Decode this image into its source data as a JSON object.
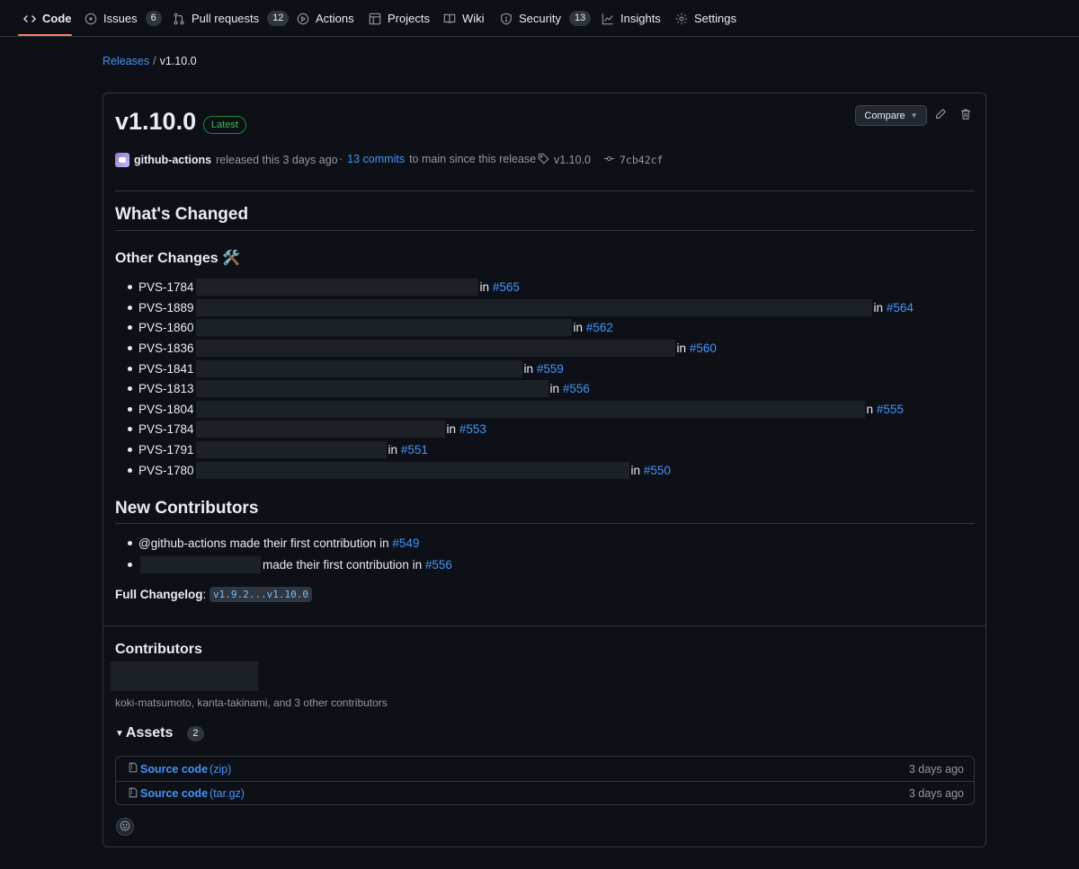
{
  "nav": {
    "code": "Code",
    "issues": "Issues",
    "issues_count": "6",
    "pulls": "Pull requests",
    "pulls_count": "12",
    "actions": "Actions",
    "projects": "Projects",
    "wiki": "Wiki",
    "security": "Security",
    "security_count": "13",
    "insights": "Insights",
    "settings": "Settings"
  },
  "breadcrumb": {
    "releases": "Releases",
    "sep": "/",
    "current": "v1.10.0"
  },
  "release": {
    "title": "v1.10.0",
    "badge": "Latest",
    "compare_label": "Compare",
    "author": "github-actions",
    "released_text": "released this 3 days ago",
    "commits_prefix": "·",
    "commits_link": "13 commits",
    "commits_suffix": "to main since this release",
    "tag": "v1.10.0",
    "commit_sha": "7cb42cf"
  },
  "body": {
    "whats_changed": "What's Changed",
    "other_changes": "Other Changes 🛠️",
    "changes": [
      {
        "id": "PVS-1784",
        "pr": "#565"
      },
      {
        "id": "PVS-1889",
        "pr": "#564"
      },
      {
        "id": "PVS-1860",
        "pr": "#562"
      },
      {
        "id": "PVS-1836",
        "pr": "#560"
      },
      {
        "id": "PVS-1841",
        "pr": "#559"
      },
      {
        "id": "PVS-1813",
        "pr": "#556"
      },
      {
        "id": "PVS-1804",
        "pr": "#555"
      },
      {
        "id": "PVS-1784",
        "pr": "#553"
      },
      {
        "id": "PVS-1791",
        "pr": "#551"
      },
      {
        "id": "PVS-1780",
        "pr": "#550"
      }
    ],
    "in_word": "in",
    "n_word": "n",
    "new_contributors": "New Contributors",
    "contrib1_text": "@github-actions made their first contribution in",
    "contrib1_pr": "#549",
    "contrib2_text": "made their first contribution in",
    "contrib2_pr": "#556",
    "full_changelog_label": "Full Changelog",
    "full_changelog_colon": ":",
    "full_changelog_link": "v1.9.2...v1.10.0"
  },
  "contributors": {
    "heading": "Contributors",
    "summary": "koki-matsumoto, kanta-takinami, and 3 other contributors"
  },
  "assets": {
    "heading": "Assets",
    "count": "2",
    "items": [
      {
        "name": "Source code",
        "ext": "(zip)",
        "date": "3 days ago"
      },
      {
        "name": "Source code",
        "ext": "(tar.gz)",
        "date": "3 days ago"
      }
    ]
  },
  "colors": {
    "accent_link": "#4493f8",
    "latest_green": "#3fb950",
    "nav_underline": "#f78166",
    "background": "#0d1117"
  }
}
